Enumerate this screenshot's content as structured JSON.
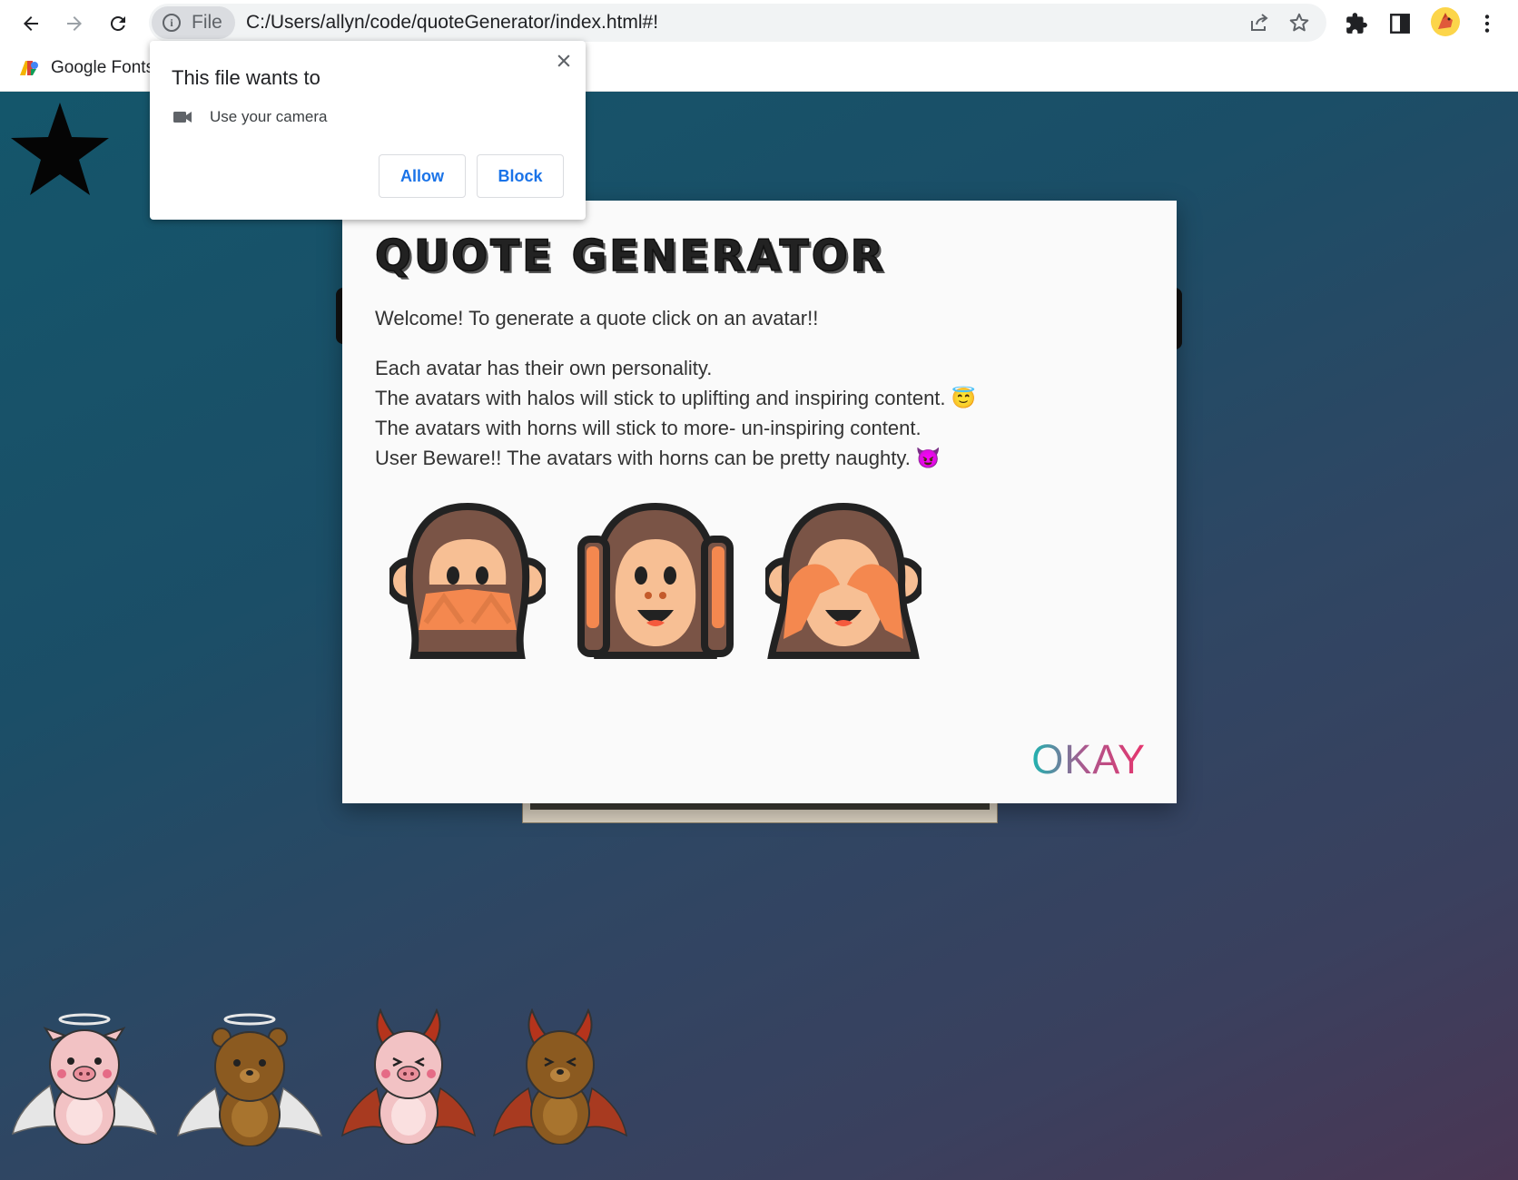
{
  "browser": {
    "site_chip_label": "File",
    "url": "C:/Users/allyn/code/quoteGenerator/index.html#!",
    "bookmarks": [
      {
        "label": "Google Fonts"
      }
    ]
  },
  "permission_prompt": {
    "title": "This file wants to",
    "permission": "Use your camera",
    "allow_label": "Allow",
    "block_label": "Block"
  },
  "modal": {
    "title": "QUOTE GENERATOR",
    "welcome": "Welcome! To generate a quote click on an avatar!!",
    "rules": [
      "Each avatar has their own personality.",
      "The avatars with halos will stick to uplifting and inspiring content. 😇",
      "The avatars with horns will stick to more- un-inspiring content.",
      "User Beware!! The avatars with horns can be pretty naughty. 😈"
    ],
    "okay_label": "OKAY",
    "monkeys": [
      "speak-no-evil-monkey",
      "hear-no-evil-monkey",
      "see-no-evil-monkey"
    ]
  },
  "avatars": [
    {
      "name": "angel-pig",
      "type": "halo"
    },
    {
      "name": "angel-bear",
      "type": "halo"
    },
    {
      "name": "devil-pig",
      "type": "horns"
    },
    {
      "name": "devil-bear",
      "type": "horns"
    }
  ],
  "colors": {
    "accent_blue": "#1a73e8",
    "okay_gradient_start": "#1cb5b0",
    "okay_gradient_end": "#e8346d",
    "page_bg_start": "#14566b",
    "page_bg_end": "#4a3654"
  }
}
